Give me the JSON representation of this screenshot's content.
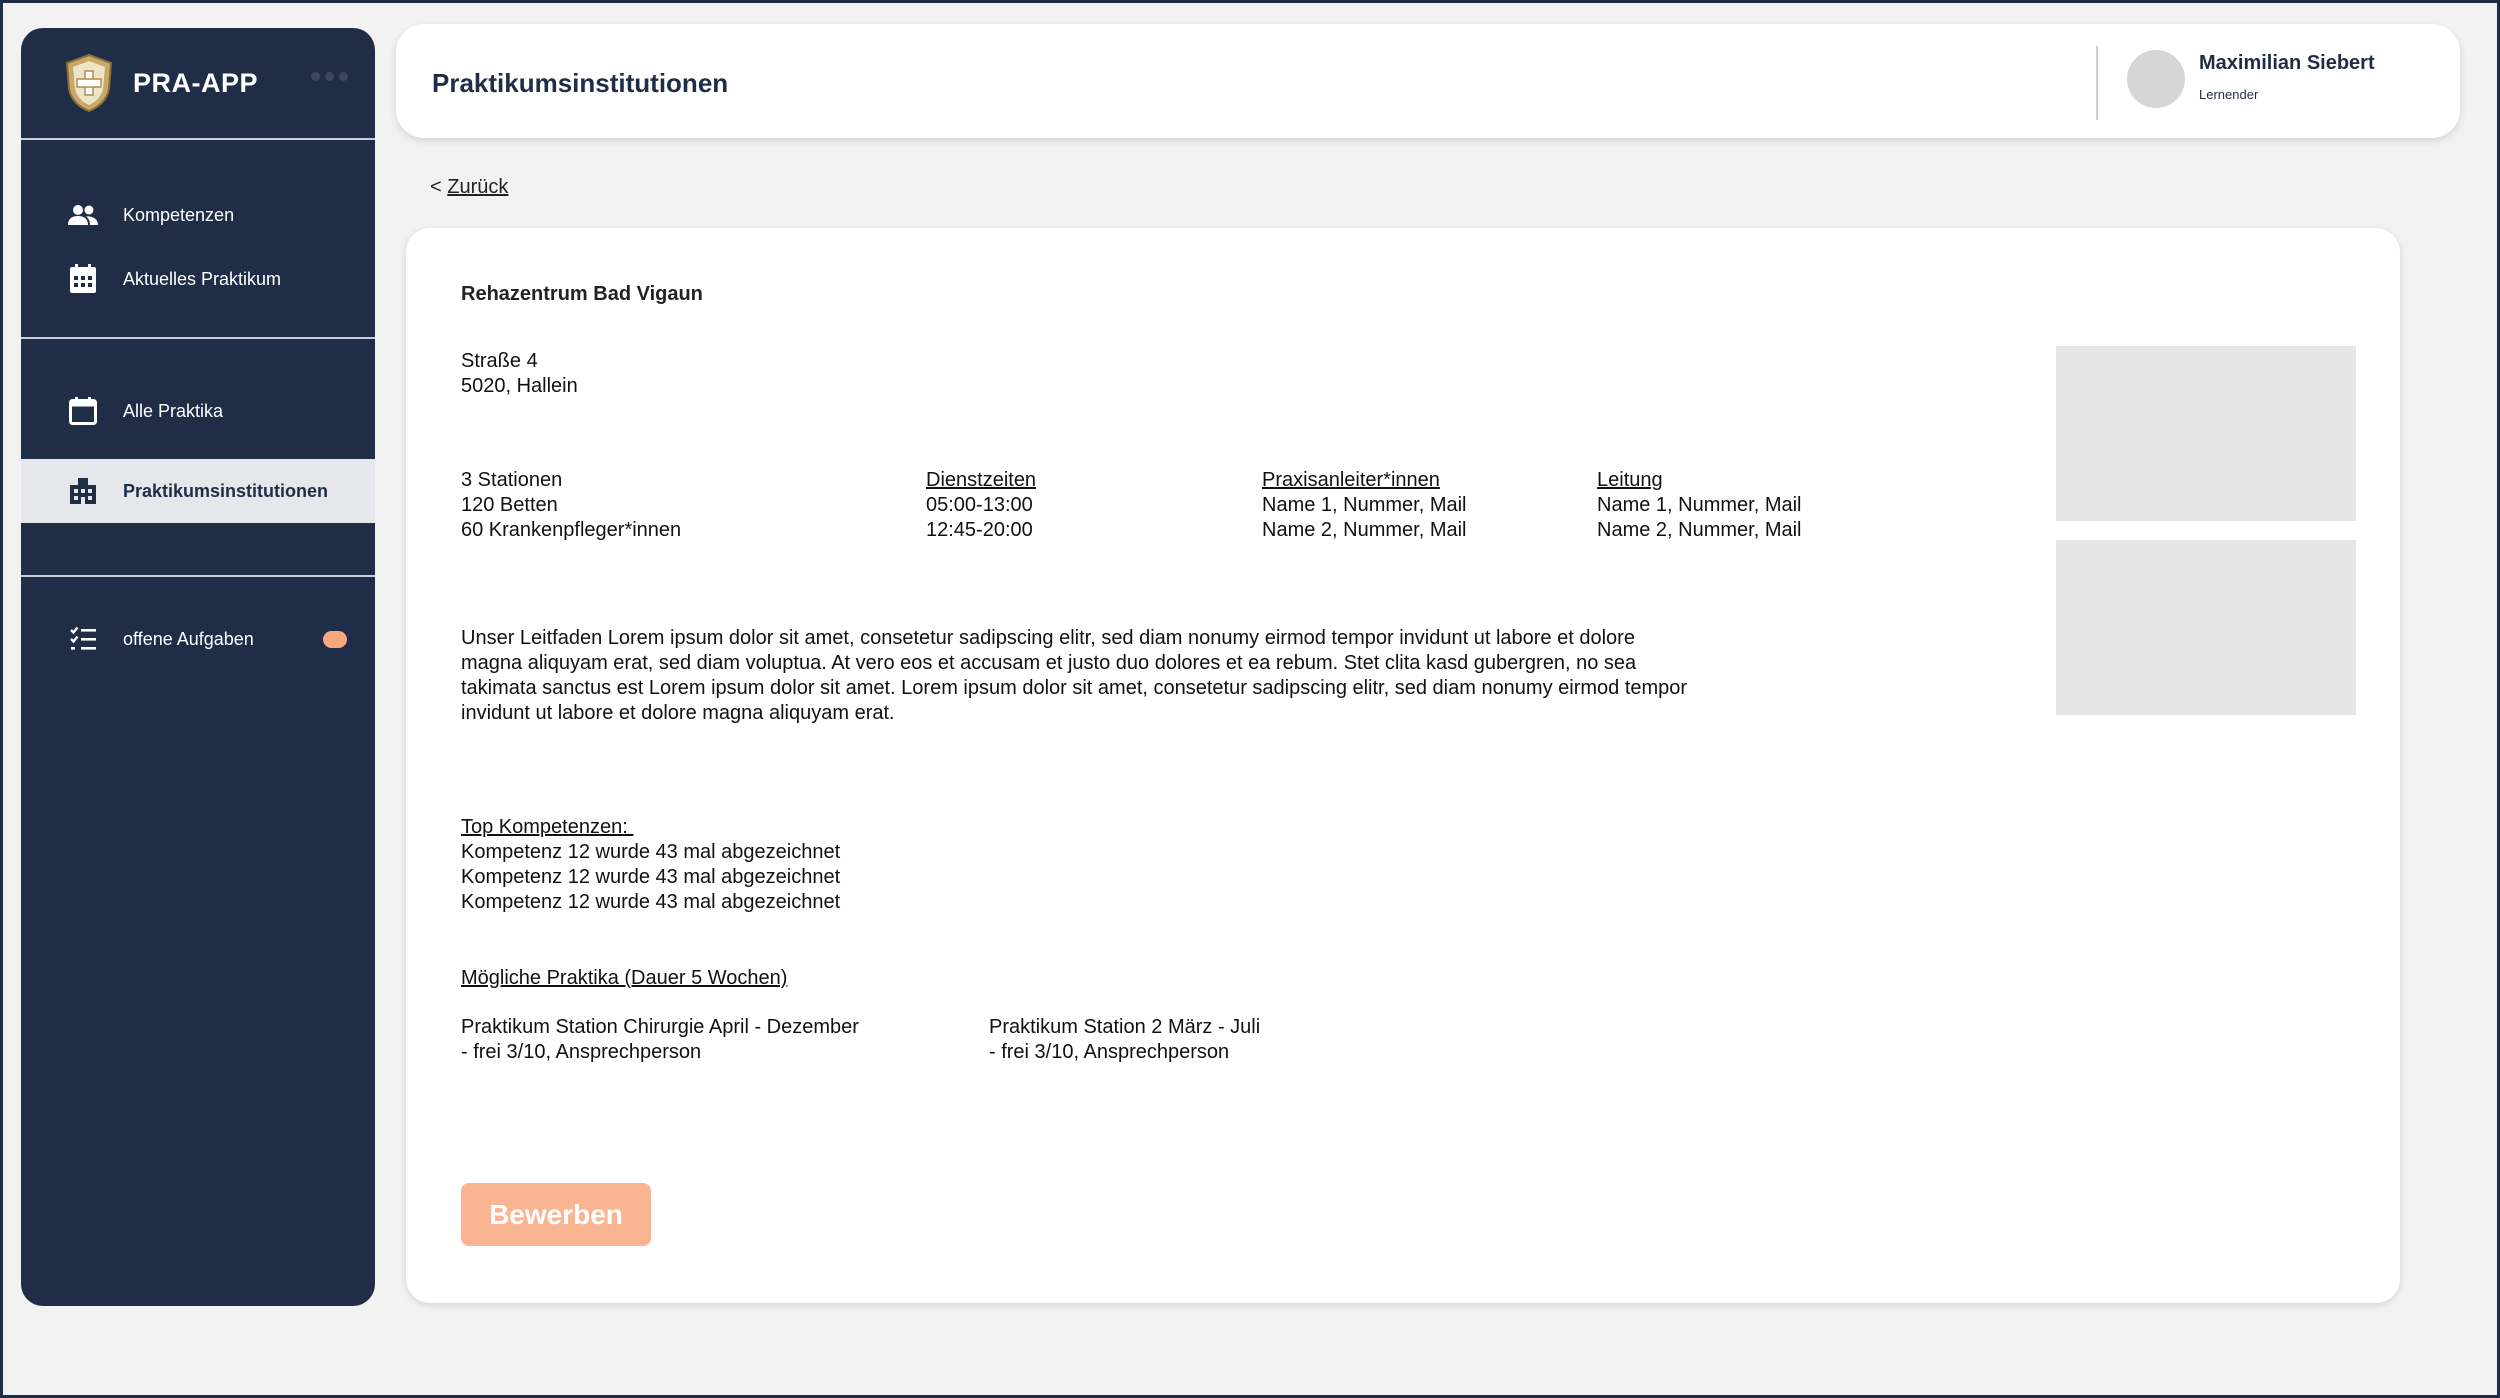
{
  "app": {
    "name": "PRA-APP"
  },
  "sidebar": {
    "items": [
      {
        "label": "Kompetenzen",
        "icon": "users-icon"
      },
      {
        "label": "Aktuelles Praktikum",
        "icon": "calendar-grid-icon"
      },
      {
        "label": "Alle Praktika",
        "icon": "calendar-icon"
      },
      {
        "label": "Praktikumsinstitutionen",
        "icon": "building-icon",
        "active": true
      },
      {
        "label": "offene Aufgaben",
        "icon": "checklist-icon"
      }
    ]
  },
  "header": {
    "title": "Praktikumsinstitutionen",
    "user_name": "Maximilian Siebert",
    "user_role": "Lernender"
  },
  "back": {
    "prefix": "< ",
    "label": "Zurück"
  },
  "institution": {
    "name": "Rehazentrum Bad Vigaun",
    "address": {
      "street": "Straße 4",
      "city": "5020, Hallein"
    },
    "facts": [
      "3 Stationen",
      "120 Betten",
      "60 Krankenpfleger*innen"
    ],
    "dienstzeiten": {
      "heading": "Dienstzeiten",
      "rows": [
        "05:00-13:00",
        "12:45-20:00"
      ]
    },
    "praxisanleiter": {
      "heading": "Praxisanleiter*innen",
      "rows": [
        "Name 1, Nummer, Mail",
        "Name 2, Nummer, Mail"
      ]
    },
    "leitung": {
      "heading": "Leitung",
      "rows": [
        "Name 1, Nummer, Mail",
        "Name 2, Nummer, Mail"
      ]
    },
    "description": "Unser Leitfaden Lorem ipsum dolor sit amet, consetetur sadipscing elitr, sed diam nonumy eirmod tempor invidunt ut labore et dolore magna aliquyam erat, sed diam voluptua. At vero eos et accusam et justo duo dolores et ea rebum. Stet clita kasd gubergren, no sea takimata sanctus est Lorem ipsum dolor sit amet. Lorem ipsum dolor sit amet, consetetur sadipscing elitr, sed diam nonumy eirmod tempor invidunt ut labore et dolore magna aliquyam erat.",
    "top_kompetenzen": {
      "heading": "Top Kompetenzen: ",
      "rows": [
        "Kompetenz 12 wurde 43 mal abgezeichnet",
        "Kompetenz 12 wurde 43 mal abgezeichnet",
        "Kompetenz 12 wurde 43 mal abgezeichnet"
      ]
    },
    "praktika": {
      "heading": "Mögliche Praktika (Dauer 5 Wochen)",
      "items": [
        {
          "title": "Praktikum Station Chirurgie April - Dezember",
          "detail": "- frei 3/10, Ansprechperson"
        },
        {
          "title": "Praktikum Station 2 März - Juli",
          "detail": "- frei 3/10, Ansprechperson"
        }
      ]
    }
  },
  "actions": {
    "apply_label": "Bewerben"
  },
  "colors": {
    "sidebar": "#1f2d47",
    "accent": "#f9b592",
    "badge": "#f7a77d",
    "active_bg": "#e5e7ea"
  }
}
